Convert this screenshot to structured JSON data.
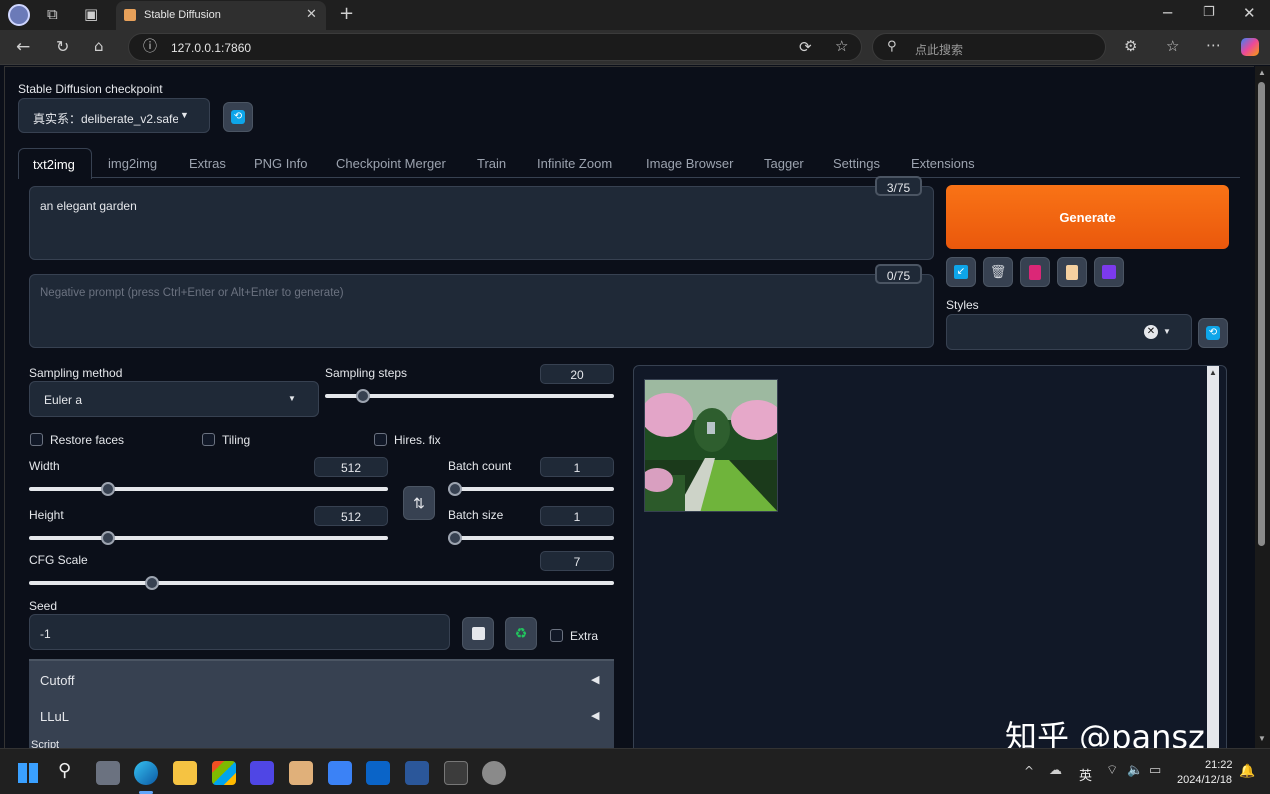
{
  "browser": {
    "tab_title": "Stable Diffusion",
    "url": "127.0.0.1:7860",
    "search_placeholder": "点此搜索"
  },
  "checkpoint": {
    "label": "Stable Diffusion checkpoint",
    "value": "真实系：deliberate_v2.safe"
  },
  "tabs": [
    "txt2img",
    "img2img",
    "Extras",
    "PNG Info",
    "Checkpoint Merger",
    "Train",
    "Infinite Zoom",
    "Image Browser",
    "Tagger",
    "Settings",
    "Extensions"
  ],
  "prompt": {
    "value": "an elegant garden",
    "token_count": "3/75",
    "negative_placeholder": "Negative prompt (press Ctrl+Enter or Alt+Enter to generate)",
    "negative_token_count": "0/75"
  },
  "generate_label": "Generate",
  "styles_label": "Styles",
  "sampling": {
    "method_label": "Sampling method",
    "method_value": "Euler a",
    "steps_label": "Sampling steps",
    "steps_value": "20",
    "steps_fraction": 0.13
  },
  "options": {
    "restore_faces": "Restore faces",
    "tiling": "Tiling",
    "hires_fix": "Hires. fix"
  },
  "width": {
    "label": "Width",
    "value": "512",
    "fraction": 0.22
  },
  "height": {
    "label": "Height",
    "value": "512",
    "fraction": 0.22
  },
  "batch_count": {
    "label": "Batch count",
    "value": "1",
    "fraction": 0
  },
  "batch_size": {
    "label": "Batch size",
    "value": "1",
    "fraction": 0
  },
  "cfg": {
    "label": "CFG Scale",
    "value": "7",
    "fraction": 0.21
  },
  "seed": {
    "label": "Seed",
    "value": "-1",
    "extra_label": "Extra"
  },
  "accordions": [
    "Cutoff",
    "LLuL"
  ],
  "script_label": "Script",
  "taskbar": {
    "time": "21:22",
    "date": "2024/12/18",
    "ime": "英"
  },
  "watermark": "知乎 @pansz",
  "colors": {
    "generate": "#f97316",
    "background": "#0b0f19",
    "panel": "#1f2937"
  }
}
